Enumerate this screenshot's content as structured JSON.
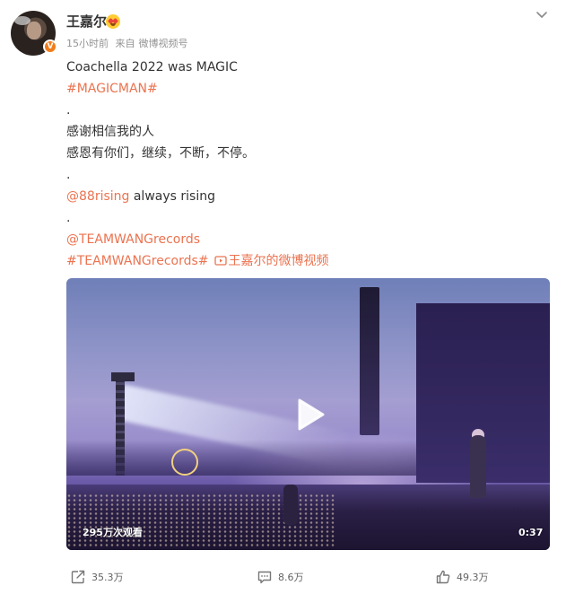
{
  "post": {
    "username": "王嘉尔",
    "time": "15小时前",
    "source_prefix": "来自",
    "source": "微博视频号",
    "lines": {
      "l1": "Coachella 2022 was MAGIC",
      "l2": "#MAGICMAN#",
      "l3": ".",
      "l4": "感谢相信我的人",
      "l5": "感恩有你们，继续，不断，不停。",
      "l6": ".",
      "l7_mention": "@88rising",
      "l7_text": " always rising",
      "l8": ".",
      "l9": "@TEAMWANGrecords",
      "l10_tag": "#TEAMWANGrecords#",
      "l10_link": "王嘉尔的微博视频"
    }
  },
  "video": {
    "views": "295万次观看",
    "duration": "0:37"
  },
  "actions": {
    "share_count": "35.3万",
    "comment_count": "8.6万",
    "like_count": "49.3万"
  },
  "colors": {
    "link": "#eb7350",
    "verified_badge": "#f27c1a"
  },
  "icons": {
    "menu": "chevron-down-icon",
    "verified": "verified-badge-icon",
    "emoji": "fan-badge-icon",
    "play": "play-icon",
    "video_link": "video-icon",
    "share": "share-icon",
    "comment": "comment-icon",
    "like": "thumbs-up-icon"
  }
}
